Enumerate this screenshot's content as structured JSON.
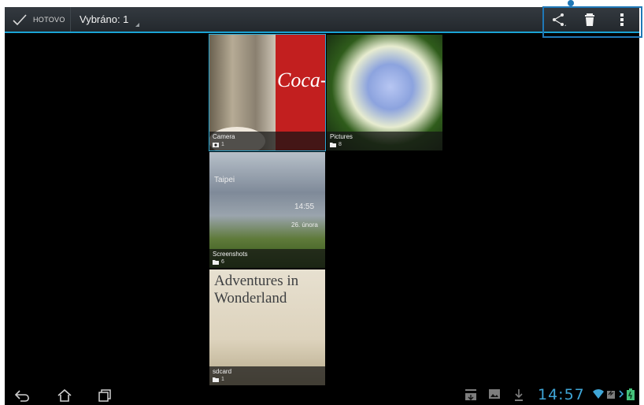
{
  "actionbar": {
    "done_label": "HOTOVO",
    "selected_label": "Vybráno: 1"
  },
  "gallery": {
    "albums": [
      {
        "name": "Camera",
        "count": "1",
        "type": "camera",
        "selected": true
      },
      {
        "name": "Pictures",
        "count": "8",
        "type": "folder",
        "selected": false
      },
      {
        "name": "Screenshots",
        "count": "6",
        "type": "folder",
        "selected": false
      },
      {
        "name": "sdcard",
        "count": "1",
        "type": "folder",
        "selected": false
      }
    ],
    "screenshot_text": {
      "city": "Taipei",
      "time": "14:55",
      "date": "26. února"
    },
    "sdcard_text": "Adventures in Wonderland"
  },
  "statusbar": {
    "time": "14:57"
  },
  "colors": {
    "accent": "#1aa3d4",
    "clock": "#3fa6d7",
    "callout": "#1f78b7"
  },
  "icons": {
    "done": "check-icon",
    "share": "share-icon",
    "delete": "trash-icon",
    "overflow": "overflow-menu-icon",
    "back": "back-icon",
    "home": "home-icon",
    "recents": "recent-apps-icon"
  }
}
